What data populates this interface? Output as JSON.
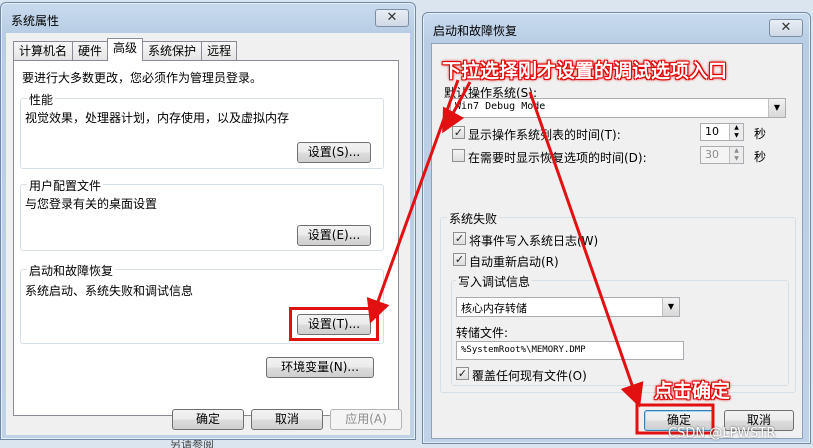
{
  "sys_props": {
    "title": "系统属性",
    "close": "✕",
    "tabs": [
      "计算机名",
      "硬件",
      "高级",
      "系统保护",
      "远程"
    ],
    "admin_note": "要进行大多数更改，您必须作为管理员登录。",
    "performance": {
      "title": "性能",
      "desc": "视觉效果，处理器计划，内存使用，以及虚拟内存",
      "button": "设置(S)..."
    },
    "user_profiles": {
      "title": "用户配置文件",
      "desc": "与您登录有关的桌面设置",
      "button": "设置(E)..."
    },
    "startup_recovery": {
      "title": "启动和故障恢复",
      "desc": "系统启动、系统失败和调试信息",
      "button": "设置(T)..."
    },
    "env_button": "环境变量(N)...",
    "ok": "确定",
    "cancel": "取消",
    "apply": "应用(A)"
  },
  "startup_dialog": {
    "title": "启动和故障恢复",
    "close": "✕",
    "default_os_label": "默认操作系统(S):",
    "default_os_value": "Win7 Debug Mode",
    "show_os_list": {
      "label": "显示操作系统列表的时间(T):",
      "checked": true,
      "value": "10",
      "unit": "秒"
    },
    "show_recovery": {
      "label": "在需要时显示恢复选项的时间(D):",
      "checked": false,
      "value": "30",
      "unit": "秒"
    },
    "system_failure_title": "系统失败",
    "write_event": {
      "label": "将事件写入系统日志(W)",
      "checked": true
    },
    "auto_restart": {
      "label": "自动重新启动(R)",
      "checked": true
    },
    "debug_info_title": "写入调试信息",
    "debug_info_value": "核心内存转储",
    "dump_file_label": "转储文件:",
    "dump_file_value": "%SystemRoot%\\MEMORY.DMP",
    "overwrite": {
      "label": "覆盖任何现有文件(O)",
      "checked": true
    },
    "ok": "确定",
    "cancel": "取消"
  },
  "annotations": {
    "dropdown_hint": "下拉选择刚才设置的调试选项入口",
    "click_ok": "点击确定",
    "color": "#e21010"
  },
  "background": {
    "partial_text": "另请参阅"
  },
  "watermark": "CSDN @LPWSTR"
}
